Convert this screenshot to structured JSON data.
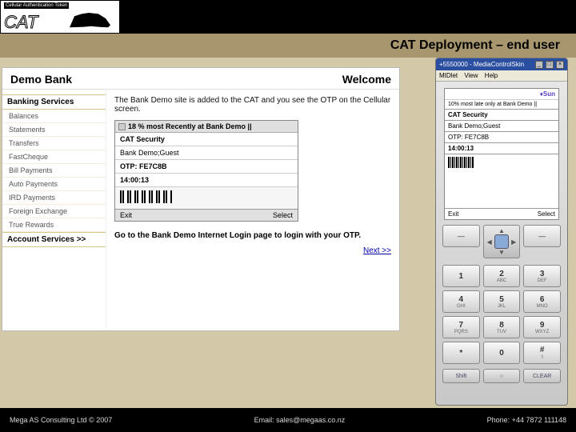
{
  "logo": {
    "small_label": "Cellular Authentication Token",
    "text": "CAT"
  },
  "title": "CAT Deployment – end user",
  "bank": {
    "name": "Demo Bank",
    "welcome": "Welcome",
    "sidebar_heading": "Banking Services",
    "sidebar_items": [
      "Balances",
      "Statements",
      "Transfers",
      "FastCheque",
      "Bill Payments",
      "Auto Payments",
      "IRD Payments",
      "Foreign Exchange",
      "True Rewards"
    ],
    "sidebar_heading2": "Account Services  >>",
    "main_text": "The Bank Demo site is added to the CAT and you see the OTP on the Cellular screen.",
    "go_text": "Go to the Bank Demo Internet Login page to login with your OTP.",
    "next": "Next >>"
  },
  "popup": {
    "title": "18 % most Recently at Bank Demo ||",
    "security_heading": "CAT Security",
    "guest": "Bank Demo;Guest",
    "otp_label": "OTP: FE7C8B",
    "time": "14:00:13",
    "foot_left": "Exit",
    "foot_right": "Select"
  },
  "phone": {
    "titlebar": "+5550000 - MediaControlSkin",
    "menu": {
      "m1": "MIDlet",
      "m2": "View",
      "m3": "Help"
    },
    "sun": "♦Sun",
    "row_tiny": "10% most late only at Bank Demo ||",
    "sec": "CAT Security",
    "guest": "Bank Demo;Guest",
    "otp": "OTP: FE7C8B",
    "time": "14:00:13",
    "foot_left": "Exit",
    "foot_right": "Select",
    "soft": {
      "left": "—",
      "right": "—"
    },
    "keys": [
      {
        "num": "1",
        "sub": ""
      },
      {
        "num": "2",
        "sub": "ABC"
      },
      {
        "num": "3",
        "sub": "DEF"
      },
      {
        "num": "4",
        "sub": "GHI"
      },
      {
        "num": "5",
        "sub": "JKL"
      },
      {
        "num": "6",
        "sub": "MNO"
      },
      {
        "num": "7",
        "sub": "PQRS"
      },
      {
        "num": "8",
        "sub": "TUV"
      },
      {
        "num": "9",
        "sub": "WXYZ"
      },
      {
        "num": "*",
        "sub": ""
      },
      {
        "num": "0",
        "sub": ""
      },
      {
        "num": "#",
        "sub": "⇧"
      }
    ],
    "bottom": {
      "b1": "Shift",
      "b2": "○",
      "b3": "CLEAR"
    }
  },
  "footer": {
    "left": "Mega AS Consulting Ltd  ©  2007",
    "mid": "Email: sales@megaas.co.nz",
    "right": "Phone: +44 7872 111148"
  }
}
